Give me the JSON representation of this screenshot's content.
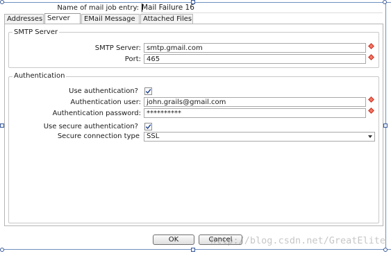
{
  "window": {
    "entry_name_label": "Name of mail job entry:",
    "entry_name_value": "Mail Failure 16"
  },
  "tabs": [
    {
      "label": "Addresses"
    },
    {
      "label": "Server",
      "active": true
    },
    {
      "label": "EMail Message"
    },
    {
      "label": "Attached Files"
    }
  ],
  "smtp": {
    "group_title": "SMTP Server",
    "server_label": "SMTP Server:",
    "server_value": "smtp.gmail.com",
    "port_label": "Port:",
    "port_value": "465"
  },
  "auth": {
    "group_title": "Authentication",
    "use_auth_label": "Use authentication?",
    "use_auth_checked": true,
    "user_label": "Authentication user:",
    "user_value": "john.grails@gmail.com",
    "password_label": "Authentication password:",
    "password_value": "**********",
    "secure_label": "Use secure authentication?",
    "secure_checked": true,
    "conn_type_label": "Secure connection type",
    "conn_type_value": "SSL"
  },
  "buttons": {
    "ok_label": "OK",
    "cancel_label": "Cancel"
  },
  "watermark": "http://blog.csdn.net/GreatElite",
  "icons": {
    "required": "diamond-required-icon",
    "dropdown": "chevron-down-icon",
    "checkbox": "checkmark-icon"
  },
  "colors": {
    "required_marker": "#d23a2a",
    "selection_frame": "#6f8fbf"
  }
}
